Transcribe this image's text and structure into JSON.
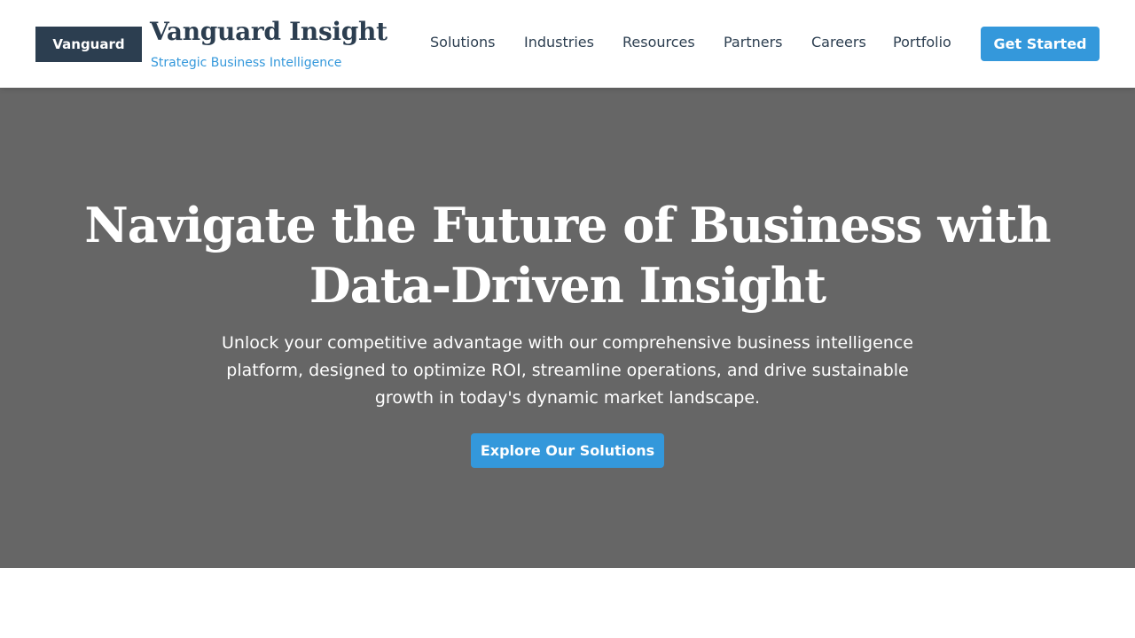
{
  "header": {
    "logo_label": "Vanguard",
    "brand_title": "Vanguard Insight",
    "brand_subtitle": "Strategic Business Intelligence",
    "nav": [
      {
        "label": "Solutions"
      },
      {
        "label": "Industries"
      },
      {
        "label": "Resources"
      },
      {
        "label": "Partners"
      },
      {
        "label": "Careers"
      },
      {
        "label": "Portfolio"
      }
    ],
    "cta_label": "Get Started"
  },
  "hero": {
    "title": "Navigate the Future of Business with Data-Driven Insight",
    "text": "Unlock your competitive advantage with our comprehensive business intelligence platform, designed to optimize ROI, streamline operations, and drive sustainable growth in today's dynamic market landscape.",
    "cta_label": "Explore Our Solutions"
  },
  "colors": {
    "primary_dark": "#2c3e50",
    "accent_blue": "#3498db",
    "hero_background": "#666666",
    "page_background": "#ffffff"
  }
}
